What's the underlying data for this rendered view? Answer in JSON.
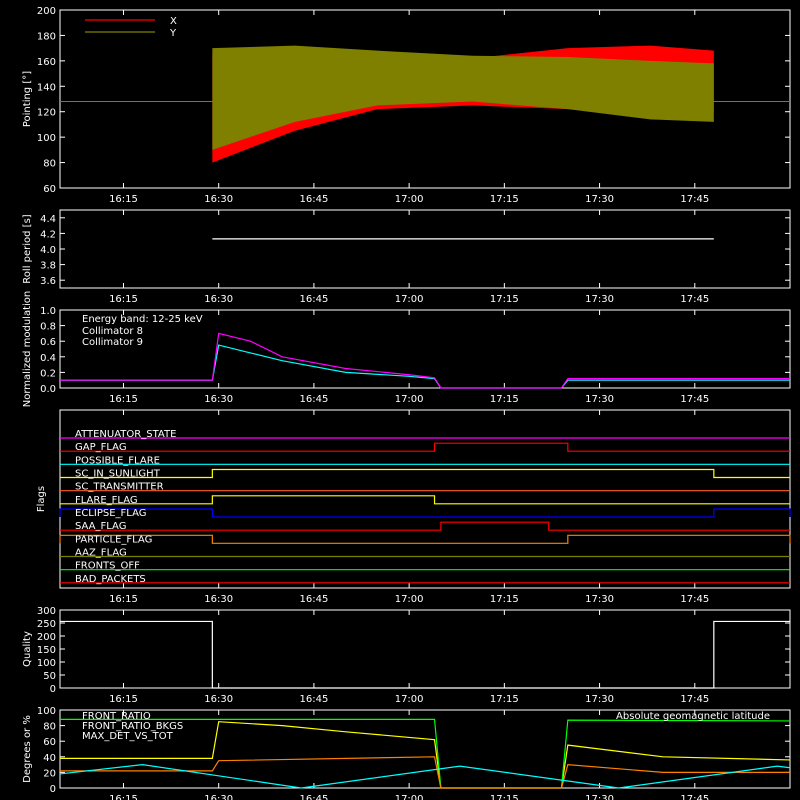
{
  "time_ticks": [
    "16:15",
    "16:30",
    "16:45",
    "17:00",
    "17:15",
    "17:30",
    "17:45"
  ],
  "time_range_min": [
    965,
    1080
  ],
  "colors": {
    "x_series": "#ff0000",
    "y_series": "#808000",
    "collimator8": "#00ffff",
    "collimator9": "#ff00ff",
    "white": "#ffffff"
  },
  "chart_data": [
    {
      "type": "area",
      "ylabel": "Pointing [°]",
      "ylim": [
        60,
        200
      ],
      "yticks": [
        60,
        80,
        100,
        120,
        140,
        160,
        180,
        200
      ],
      "legend_position": "top-left",
      "series": [
        {
          "name": "X",
          "color": "#ff0000",
          "x_min": [
            989,
            1002,
            1015,
            1030,
            1045,
            1058,
            1068
          ],
          "upper": [
            165,
            168,
            165,
            162,
            170,
            172,
            168
          ],
          "lower": [
            80,
            105,
            122,
            125,
            122,
            118,
            120
          ]
        },
        {
          "name": "Y",
          "color": "#808000",
          "x_min": [
            989,
            1002,
            1015,
            1030,
            1045,
            1058,
            1068
          ],
          "upper": [
            170,
            172,
            168,
            164,
            163,
            160,
            158
          ],
          "lower": [
            90,
            112,
            125,
            128,
            122,
            114,
            112
          ]
        }
      ],
      "baseline": 128
    },
    {
      "type": "line",
      "ylabel": "Roll period [s]",
      "ylim": [
        3.5,
        4.5
      ],
      "yticks": [
        3.6,
        3.8,
        4.0,
        4.2,
        4.4
      ],
      "series": [
        {
          "name": "",
          "x_min": [
            989,
            1068
          ],
          "values": [
            4.13,
            4.13
          ]
        }
      ]
    },
    {
      "type": "line",
      "ylabel": "Normalized modulation",
      "ylim": [
        0,
        1
      ],
      "yticks": [
        0.0,
        0.2,
        0.4,
        0.6,
        0.8,
        1.0
      ],
      "annotation": "Energy band: 12-25 keV",
      "series": [
        {
          "name": "Collimator 8",
          "color": "#00ffff",
          "x_min": [
            965,
            989,
            990,
            995,
            1000,
            1010,
            1020,
            1024,
            1025,
            1044,
            1045,
            1080
          ],
          "values": [
            0.1,
            0.1,
            0.55,
            0.45,
            0.35,
            0.2,
            0.15,
            0.12,
            0.0,
            0.0,
            0.1,
            0.1
          ]
        },
        {
          "name": "Collimator 9",
          "color": "#ff00ff",
          "x_min": [
            965,
            989,
            990,
            995,
            1000,
            1010,
            1020,
            1024,
            1025,
            1044,
            1045,
            1080
          ],
          "values": [
            0.1,
            0.1,
            0.7,
            0.6,
            0.4,
            0.25,
            0.17,
            0.13,
            0.0,
            0.0,
            0.12,
            0.12
          ]
        }
      ]
    },
    {
      "type": "line",
      "ylabel": "Flags",
      "flags": [
        {
          "name": "ATTENUATOR_STATE",
          "color": "#ff00ff",
          "on": []
        },
        {
          "name": "GAP_FLAG",
          "color": "#ff0000",
          "on": [
            [
              1024,
              1045
            ]
          ]
        },
        {
          "name": "POSSIBLE_FLARE",
          "color": "#00ffff",
          "on": []
        },
        {
          "name": "SC_IN_SUNLIGHT",
          "color": "#ffff00",
          "on": [
            [
              989,
              1068
            ]
          ]
        },
        {
          "name": "SC_TRANSMITTER",
          "color": "#ff6020",
          "on": []
        },
        {
          "name": "FLARE_FLAG",
          "color": "#ffff00",
          "on": [
            [
              989,
              1024
            ]
          ]
        },
        {
          "name": "ECLIPSE_FLAG",
          "color": "#0000ff",
          "on": [
            [
              965,
              989
            ],
            [
              1068,
              1080
            ]
          ]
        },
        {
          "name": "SAA_FLAG",
          "color": "#ff0000",
          "on": [
            [
              1025,
              1042
            ]
          ]
        },
        {
          "name": "PARTICLE_FLAG",
          "color": "#ff8000",
          "on": [
            [
              965,
              989
            ],
            [
              1045,
              1080
            ]
          ]
        },
        {
          "name": "AAZ_FLAG",
          "color": "#808000",
          "on": []
        },
        {
          "name": "FRONTS_OFF",
          "color": "#00ff00",
          "on": []
        },
        {
          "name": "BAD_PACKETS",
          "color": "#ff0000",
          "on": []
        }
      ]
    },
    {
      "type": "line",
      "ylabel": "Quality",
      "ylim": [
        0,
        300
      ],
      "yticks": [
        0,
        50,
        100,
        150,
        200,
        250,
        300
      ],
      "series": [
        {
          "name": "",
          "x_min": [
            965,
            989,
            989,
            1068,
            1068,
            1080
          ],
          "values": [
            256,
            256,
            0,
            0,
            256,
            256
          ]
        }
      ]
    },
    {
      "type": "line",
      "ylabel": "Degrees or %",
      "ylim": [
        0,
        100
      ],
      "yticks": [
        0,
        20,
        40,
        60,
        80,
        100
      ],
      "series": [
        {
          "name": "FRONT_RATIO",
          "color": "#ffff00",
          "x_min": [
            965,
            989,
            990,
            1000,
            1010,
            1024,
            1025,
            1044,
            1045,
            1060,
            1080
          ],
          "values": [
            38,
            38,
            85,
            80,
            72,
            62,
            0,
            0,
            55,
            40,
            36
          ]
        },
        {
          "name": "FRONT_RATIO_BKGS",
          "color": "#00ff00",
          "x_min": [
            965,
            1024,
            1025,
            1044,
            1045,
            1080
          ],
          "values": [
            88,
            88,
            0,
            0,
            87,
            86
          ]
        },
        {
          "name": "MAX_DET_VS_TOT",
          "color": "#ff8000",
          "x_min": [
            965,
            989,
            990,
            1024,
            1025,
            1044,
            1045,
            1060,
            1080
          ],
          "values": [
            22,
            22,
            35,
            40,
            0,
            0,
            30,
            20,
            20
          ]
        },
        {
          "name": "Absolute geomagnetic latitude",
          "color": "#00ffff",
          "x_min": [
            965,
            978,
            1003,
            1028,
            1053,
            1078,
            1080
          ],
          "values": [
            18,
            30,
            0,
            28,
            0,
            28,
            26
          ]
        }
      ]
    }
  ]
}
